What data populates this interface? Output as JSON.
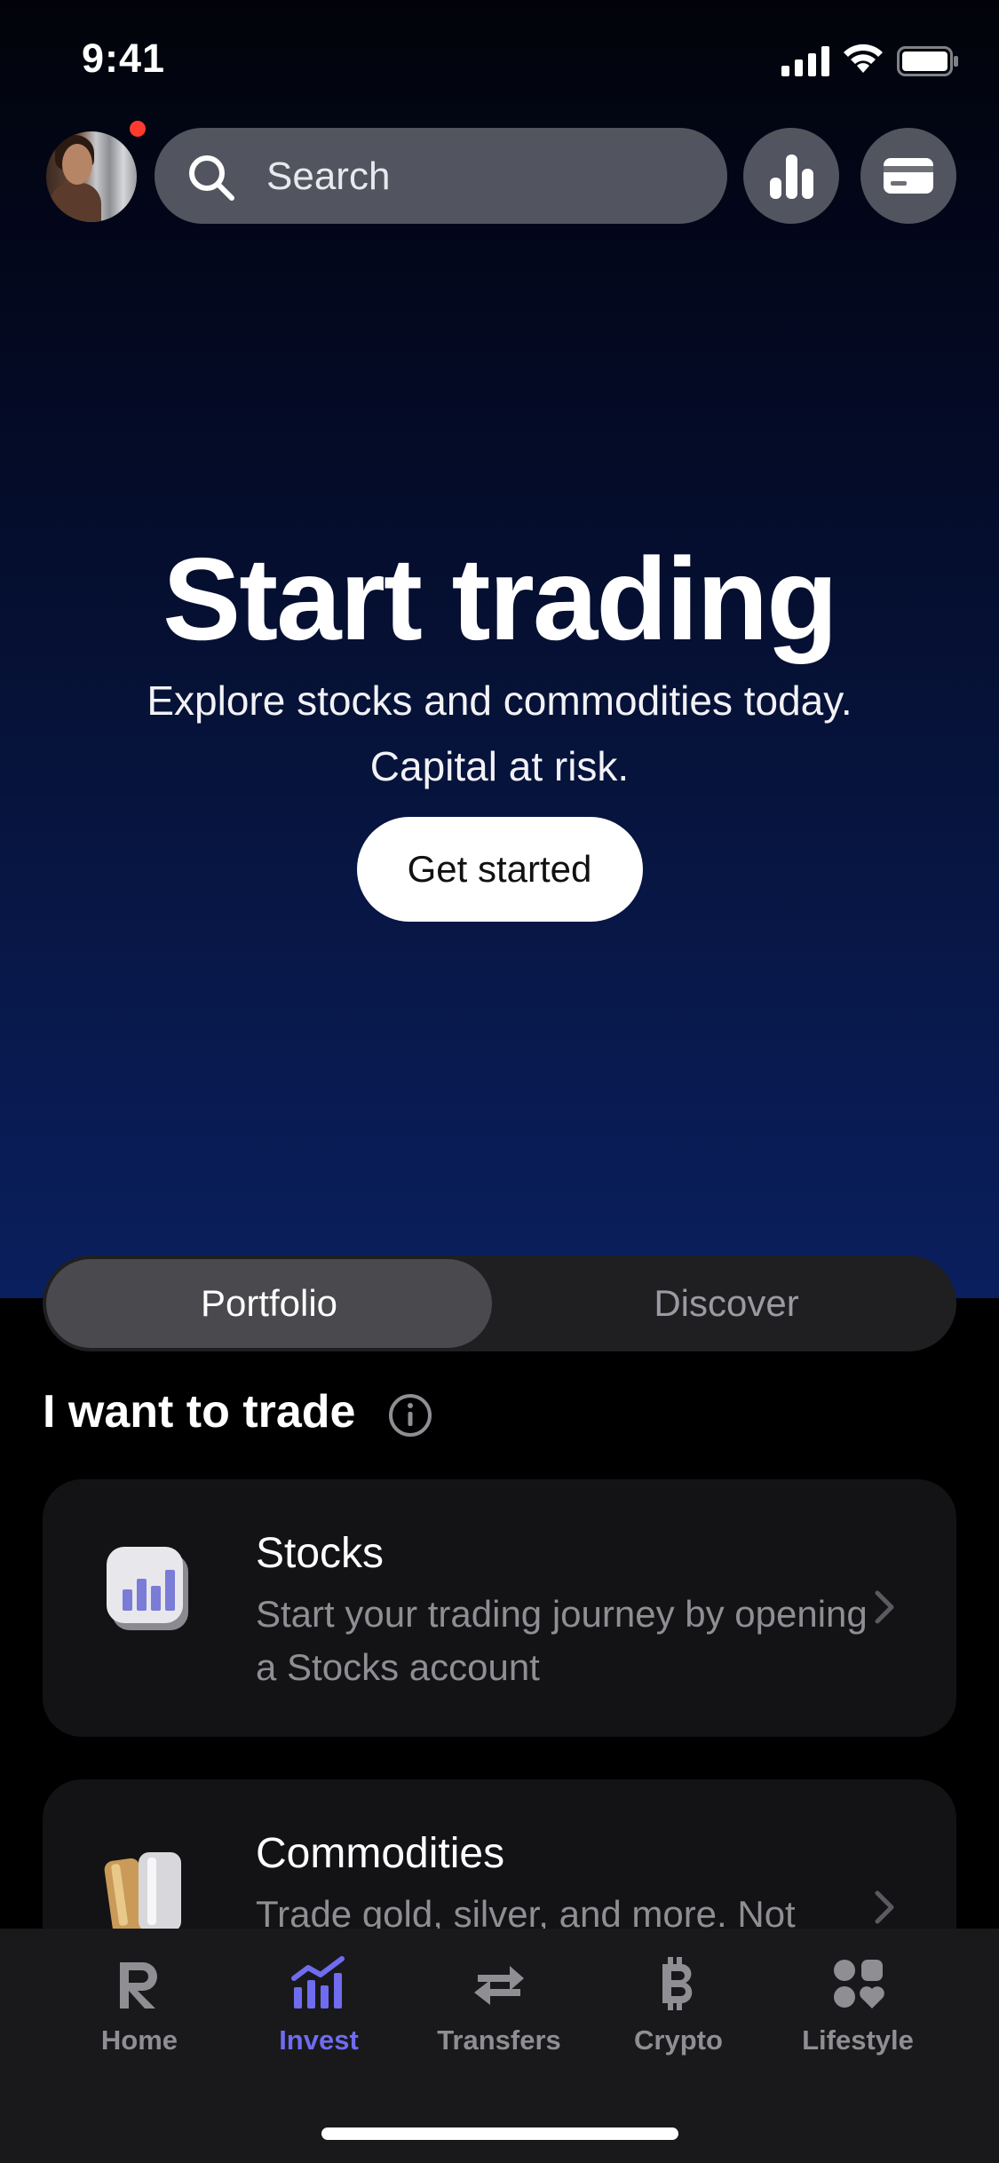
{
  "status_bar": {
    "time": "9:41"
  },
  "header": {
    "search_placeholder": "Search",
    "icons": [
      "avatar",
      "search-icon",
      "analytics-icon",
      "card-icon"
    ]
  },
  "hero": {
    "title": "Start trading",
    "subtitle_line1": "Explore stocks and commodities today.",
    "subtitle_line2": "Capital at risk.",
    "cta_label": "Get started"
  },
  "segmented_control": {
    "items": [
      {
        "label": "Portfolio",
        "selected": true
      },
      {
        "label": "Discover",
        "selected": false
      }
    ]
  },
  "section": {
    "title": "I want to trade",
    "cards": [
      {
        "title": "Stocks",
        "description": "Start your trading journey by opening a Stocks account",
        "icon": "stocks-icon"
      },
      {
        "title": "Commodities",
        "description": "Trade gold, silver, and more. Not",
        "icon": "commodities-icon"
      }
    ]
  },
  "tab_bar": {
    "tabs": [
      {
        "label": "Home",
        "icon": "revolut-r-icon",
        "active": false
      },
      {
        "label": "Invest",
        "icon": "invest-chart-icon",
        "active": true
      },
      {
        "label": "Transfers",
        "icon": "transfer-arrows-icon",
        "active": false
      },
      {
        "label": "Crypto",
        "icon": "bitcoin-icon",
        "active": false
      },
      {
        "label": "Lifestyle",
        "icon": "lifestyle-icon",
        "active": false
      }
    ]
  },
  "colors": {
    "accent": "#6f6cf0",
    "notification": "#ff3b30",
    "hero_gradient_top": "#02030a",
    "hero_gradient_bottom": "#0a1f5e"
  }
}
